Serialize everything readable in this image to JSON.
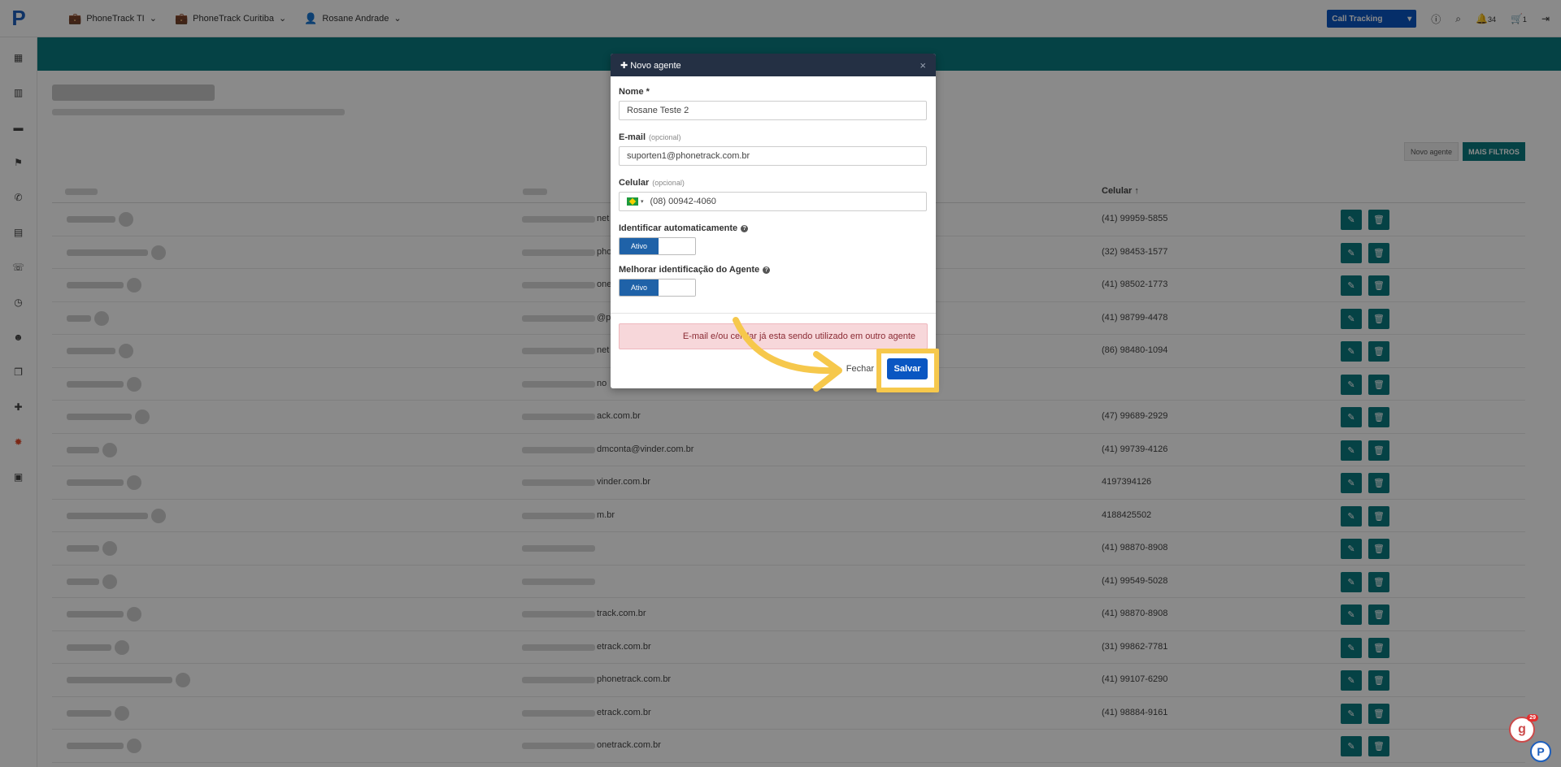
{
  "topbar": {
    "logo_letter": "P",
    "company1": "PhoneTrack TI",
    "company2": "PhoneTrack Curitiba",
    "user": "Rosane Andrade",
    "product_select": "Call Tracking",
    "notifications_count": "34",
    "cart_count": "1"
  },
  "sidebar": {
    "items": [
      "dashboard-icon",
      "building-icon",
      "briefcase-icon",
      "flag-icon",
      "phone-icon",
      "id-card-icon",
      "phone-forward-icon",
      "clock-icon",
      "users-icon",
      "layers-icon",
      "puzzle-icon",
      "settings-icon",
      "store-icon"
    ],
    "active_index": 11
  },
  "toolbar": {
    "novo_agente": "Novo agente",
    "mais_filtros": "MAIS FILTROS"
  },
  "table": {
    "col_celular": "Celular",
    "rows": [
      {
        "email": "net",
        "celular": "(41) 99959-5855"
      },
      {
        "email": "pho",
        "celular": "(32) 98453-1577"
      },
      {
        "email": "one",
        "celular": "(41) 98502-1773"
      },
      {
        "email": "@p",
        "celular": "(41) 98799-4478"
      },
      {
        "email": "net",
        "celular": "(86) 98480-1094"
      },
      {
        "email": "no",
        "celular": ""
      },
      {
        "email": "ack.com.br",
        "celular": "(47) 99689-2929"
      },
      {
        "email": "dmconta@vinder.com.br",
        "celular": "(41) 99739-4126"
      },
      {
        "email": "vinder.com.br",
        "celular": "4197394126"
      },
      {
        "email": "m.br",
        "celular": "4188425502"
      },
      {
        "email": "",
        "celular": "(41) 98870-8908"
      },
      {
        "email": "",
        "celular": "(41) 99549-5028"
      },
      {
        "email": "track.com.br",
        "celular": "(41) 98870-8908"
      },
      {
        "email": "etrack.com.br",
        "celular": "(31) 99862-7781"
      },
      {
        "email": "phonetrack.com.br",
        "celular": "(41) 99107-6290"
      },
      {
        "email": "etrack.com.br",
        "celular": "(41) 98884-9161"
      },
      {
        "email": "onetrack.com.br",
        "celular": ""
      }
    ]
  },
  "modal": {
    "title": "Novo agente",
    "nome_label": "Nome *",
    "nome_value": "Rosane Teste 2",
    "email_label": "E-mail",
    "email_opt": "(opcional)",
    "email_value": "suporten1@phonetrack.com.br",
    "celular_label": "Celular",
    "celular_opt": "(opcional)",
    "celular_value": "(08) 00942-4060",
    "ident_label": "Identificar automaticamente",
    "ident_toggle": "Ativo",
    "melhorar_label": "Melhorar identificação do Agente",
    "melhorar_toggle": "Ativo",
    "alert": "E-mail e/ou celular já esta sendo utilizado em outro agente",
    "fechar": "Fechar",
    "salvar": "Salvar"
  },
  "widgets": {
    "chat_badge": "29",
    "chat_letter": "g",
    "brand_letter": "P"
  },
  "colors": {
    "teal": "#0b7b80",
    "primary": "#0a56c2",
    "highlight": "#f6c84c",
    "alert_bg": "#f7d7da"
  }
}
